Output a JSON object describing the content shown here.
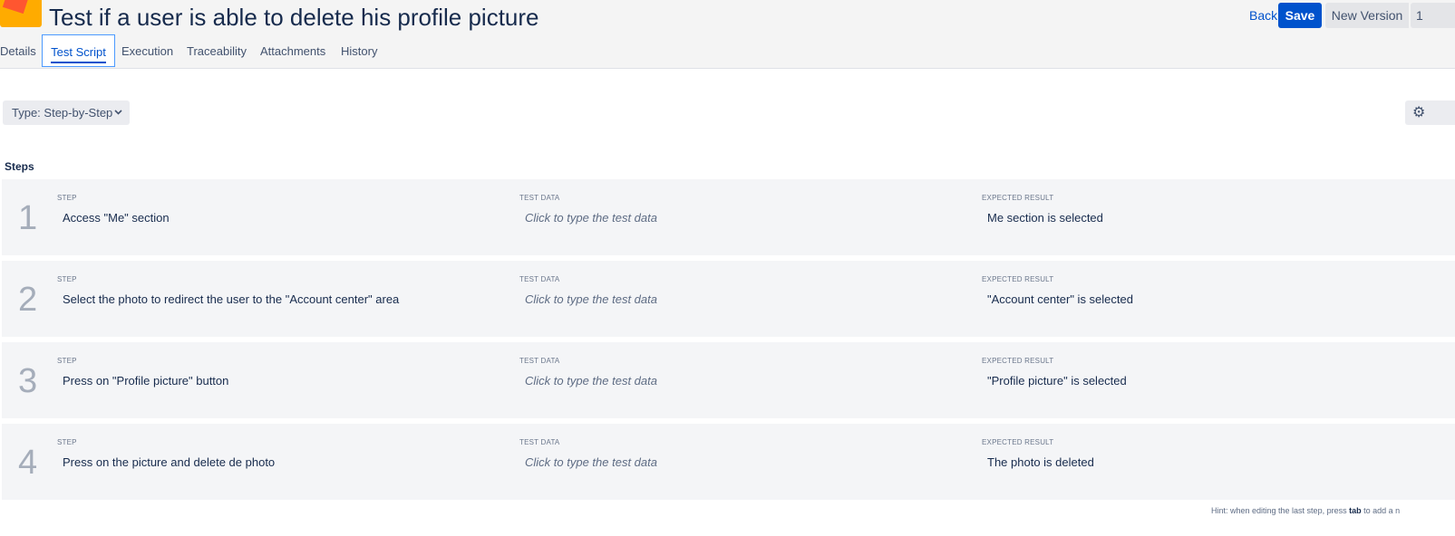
{
  "header": {
    "title": "Test if a user is able to delete his profile picture",
    "back_label": "Back",
    "save_label": "Save",
    "new_version_label": "New Version",
    "version_value": "1"
  },
  "tabs": [
    {
      "label": "Details",
      "active": false
    },
    {
      "label": "Test Script",
      "active": true
    },
    {
      "label": "Execution",
      "active": false
    },
    {
      "label": "Traceability",
      "active": false
    },
    {
      "label": "Attachments",
      "active": false
    },
    {
      "label": "History",
      "active": false
    }
  ],
  "type_select": {
    "label": "Type: Step-by-Step"
  },
  "steps_section": {
    "heading": "Steps",
    "column_labels": {
      "step": "STEP",
      "test_data": "TEST DATA",
      "expected": "EXPECTED RESULT"
    },
    "steps": [
      {
        "number": "1",
        "step": "Access \"Me\" section",
        "test_data": "Click to type the test data",
        "expected": "Me section is selected"
      },
      {
        "number": "2",
        "step": "Select the photo to redirect the user to the \"Account center\" area",
        "test_data": "Click to type the test data",
        "expected": "\"Account center\" is selected"
      },
      {
        "number": "3",
        "step": "Press on \"Profile picture\" button",
        "test_data": "Click to type the test data",
        "expected": "\"Profile picture\" is selected"
      },
      {
        "number": "4",
        "step": "Press on the picture and delete de photo",
        "test_data": "Click to type the test data",
        "expected": "The photo is deleted"
      }
    ]
  },
  "hint": {
    "prefix": "Hint: when editing the last step, press ",
    "key": "tab",
    "suffix": " to add a n"
  },
  "icons": {
    "logo": "app-logo-icon",
    "chevron": "chevron-down-icon",
    "settings": "gear-icon"
  },
  "colors": {
    "primary": "#0052cc",
    "header_bg": "#f4f4f4",
    "row_bg": "#f4f5f7"
  }
}
